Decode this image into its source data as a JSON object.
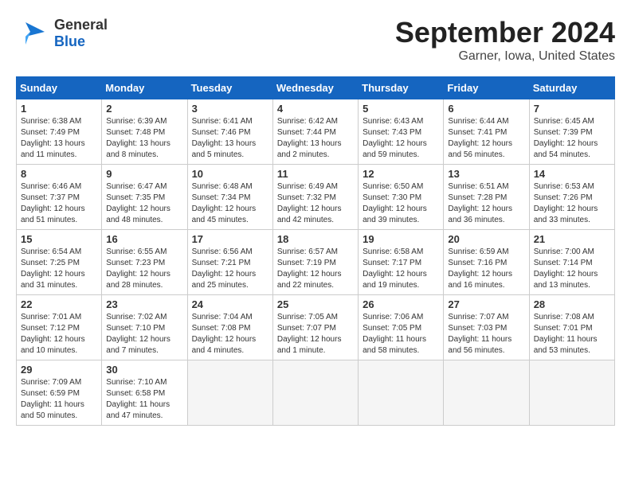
{
  "header": {
    "logo_line1": "General",
    "logo_line2": "Blue",
    "month_title": "September 2024",
    "location": "Garner, Iowa, United States"
  },
  "weekdays": [
    "Sunday",
    "Monday",
    "Tuesday",
    "Wednesday",
    "Thursday",
    "Friday",
    "Saturday"
  ],
  "weeks": [
    [
      {
        "day": "1",
        "info": "Sunrise: 6:38 AM\nSunset: 7:49 PM\nDaylight: 13 hours\nand 11 minutes."
      },
      {
        "day": "2",
        "info": "Sunrise: 6:39 AM\nSunset: 7:48 PM\nDaylight: 13 hours\nand 8 minutes."
      },
      {
        "day": "3",
        "info": "Sunrise: 6:41 AM\nSunset: 7:46 PM\nDaylight: 13 hours\nand 5 minutes."
      },
      {
        "day": "4",
        "info": "Sunrise: 6:42 AM\nSunset: 7:44 PM\nDaylight: 13 hours\nand 2 minutes."
      },
      {
        "day": "5",
        "info": "Sunrise: 6:43 AM\nSunset: 7:43 PM\nDaylight: 12 hours\nand 59 minutes."
      },
      {
        "day": "6",
        "info": "Sunrise: 6:44 AM\nSunset: 7:41 PM\nDaylight: 12 hours\nand 56 minutes."
      },
      {
        "day": "7",
        "info": "Sunrise: 6:45 AM\nSunset: 7:39 PM\nDaylight: 12 hours\nand 54 minutes."
      }
    ],
    [
      {
        "day": "8",
        "info": "Sunrise: 6:46 AM\nSunset: 7:37 PM\nDaylight: 12 hours\nand 51 minutes."
      },
      {
        "day": "9",
        "info": "Sunrise: 6:47 AM\nSunset: 7:35 PM\nDaylight: 12 hours\nand 48 minutes."
      },
      {
        "day": "10",
        "info": "Sunrise: 6:48 AM\nSunset: 7:34 PM\nDaylight: 12 hours\nand 45 minutes."
      },
      {
        "day": "11",
        "info": "Sunrise: 6:49 AM\nSunset: 7:32 PM\nDaylight: 12 hours\nand 42 minutes."
      },
      {
        "day": "12",
        "info": "Sunrise: 6:50 AM\nSunset: 7:30 PM\nDaylight: 12 hours\nand 39 minutes."
      },
      {
        "day": "13",
        "info": "Sunrise: 6:51 AM\nSunset: 7:28 PM\nDaylight: 12 hours\nand 36 minutes."
      },
      {
        "day": "14",
        "info": "Sunrise: 6:53 AM\nSunset: 7:26 PM\nDaylight: 12 hours\nand 33 minutes."
      }
    ],
    [
      {
        "day": "15",
        "info": "Sunrise: 6:54 AM\nSunset: 7:25 PM\nDaylight: 12 hours\nand 31 minutes."
      },
      {
        "day": "16",
        "info": "Sunrise: 6:55 AM\nSunset: 7:23 PM\nDaylight: 12 hours\nand 28 minutes."
      },
      {
        "day": "17",
        "info": "Sunrise: 6:56 AM\nSunset: 7:21 PM\nDaylight: 12 hours\nand 25 minutes."
      },
      {
        "day": "18",
        "info": "Sunrise: 6:57 AM\nSunset: 7:19 PM\nDaylight: 12 hours\nand 22 minutes."
      },
      {
        "day": "19",
        "info": "Sunrise: 6:58 AM\nSunset: 7:17 PM\nDaylight: 12 hours\nand 19 minutes."
      },
      {
        "day": "20",
        "info": "Sunrise: 6:59 AM\nSunset: 7:16 PM\nDaylight: 12 hours\nand 16 minutes."
      },
      {
        "day": "21",
        "info": "Sunrise: 7:00 AM\nSunset: 7:14 PM\nDaylight: 12 hours\nand 13 minutes."
      }
    ],
    [
      {
        "day": "22",
        "info": "Sunrise: 7:01 AM\nSunset: 7:12 PM\nDaylight: 12 hours\nand 10 minutes."
      },
      {
        "day": "23",
        "info": "Sunrise: 7:02 AM\nSunset: 7:10 PM\nDaylight: 12 hours\nand 7 minutes."
      },
      {
        "day": "24",
        "info": "Sunrise: 7:04 AM\nSunset: 7:08 PM\nDaylight: 12 hours\nand 4 minutes."
      },
      {
        "day": "25",
        "info": "Sunrise: 7:05 AM\nSunset: 7:07 PM\nDaylight: 12 hours\nand 1 minute."
      },
      {
        "day": "26",
        "info": "Sunrise: 7:06 AM\nSunset: 7:05 PM\nDaylight: 11 hours\nand 58 minutes."
      },
      {
        "day": "27",
        "info": "Sunrise: 7:07 AM\nSunset: 7:03 PM\nDaylight: 11 hours\nand 56 minutes."
      },
      {
        "day": "28",
        "info": "Sunrise: 7:08 AM\nSunset: 7:01 PM\nDaylight: 11 hours\nand 53 minutes."
      }
    ],
    [
      {
        "day": "29",
        "info": "Sunrise: 7:09 AM\nSunset: 6:59 PM\nDaylight: 11 hours\nand 50 minutes."
      },
      {
        "day": "30",
        "info": "Sunrise: 7:10 AM\nSunset: 6:58 PM\nDaylight: 11 hours\nand 47 minutes."
      },
      null,
      null,
      null,
      null,
      null
    ]
  ]
}
